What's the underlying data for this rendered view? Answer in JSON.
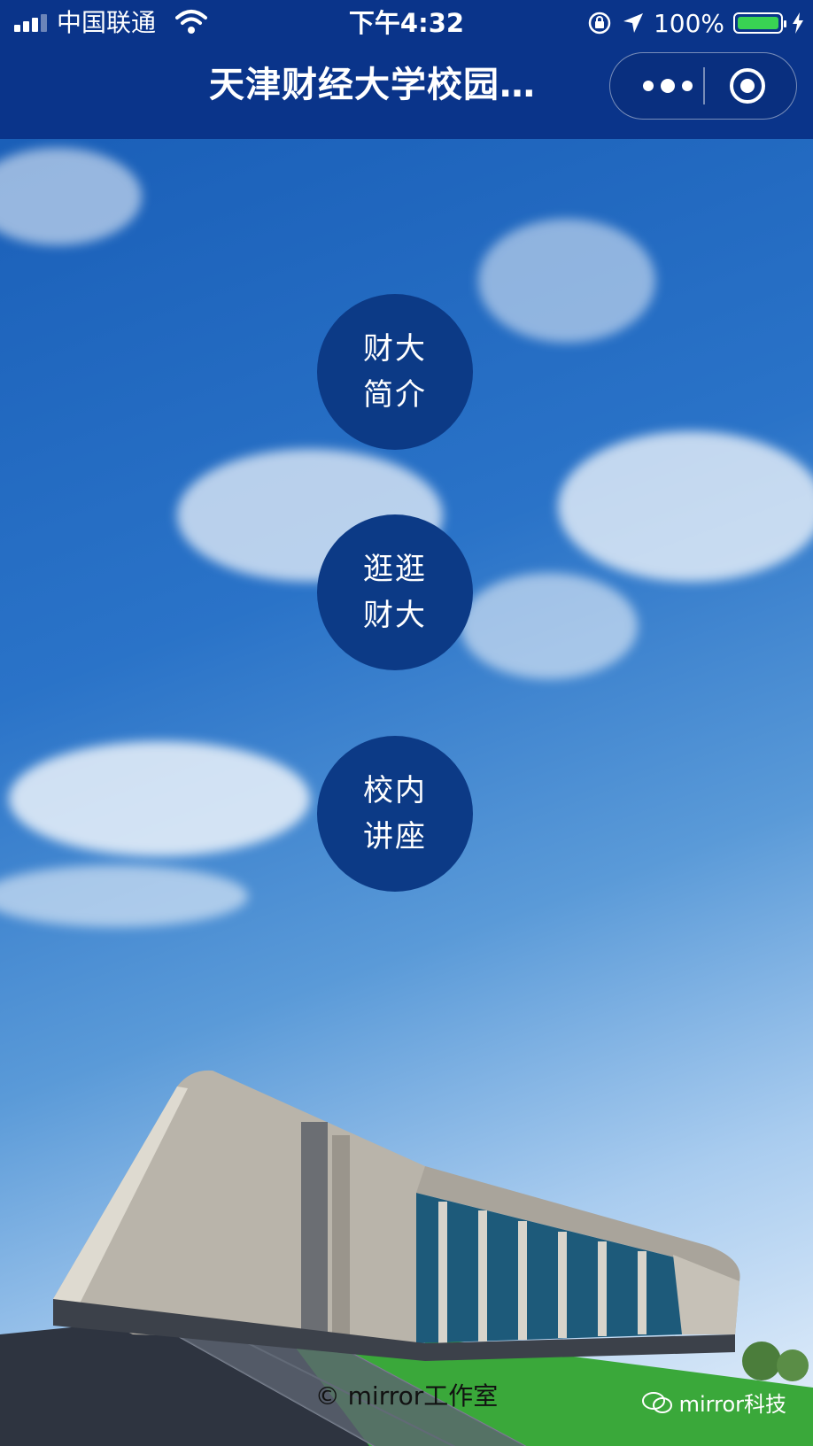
{
  "status_bar": {
    "carrier": "中国联通",
    "time": "下午4:32",
    "battery": "100%"
  },
  "nav": {
    "title": "天津财经大学校园…"
  },
  "menu": [
    {
      "line1": "财大",
      "line2": "简介"
    },
    {
      "line1": "逛逛",
      "line2": "财大"
    },
    {
      "line1": "校内",
      "line2": "讲座"
    }
  ],
  "footer": {
    "copyright": "© mirror工作室",
    "watermark": "mirror科技"
  },
  "colors": {
    "nav_bg": "#0a348a",
    "circle_bg": "#0c3a86",
    "battery": "#39d353"
  }
}
